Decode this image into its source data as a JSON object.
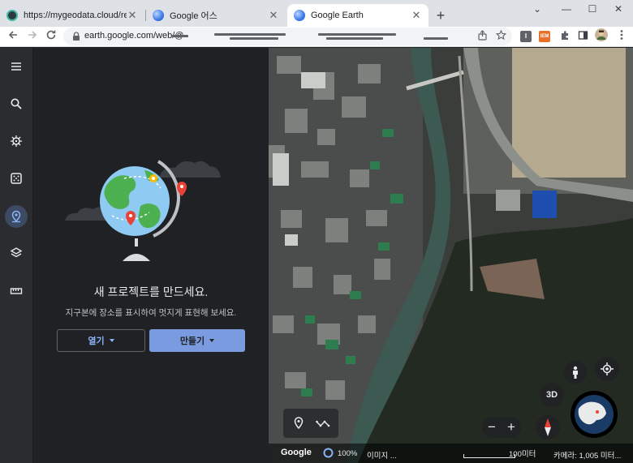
{
  "browser": {
    "tabs": [
      {
        "title": "https://mygeodata.cloud/result",
        "active": false
      },
      {
        "title": "Google 어스",
        "active": false
      },
      {
        "title": "Google Earth",
        "active": true
      }
    ],
    "new_tab": "+",
    "window_controls": {
      "minimize": "—",
      "maximize": "☐",
      "close": "✕",
      "dropdown": "⌄"
    },
    "url": "earth.google.com/web/@",
    "extensions": {
      "ext1": "I",
      "ext2": "IEM"
    }
  },
  "panel": {
    "heading": "새 프로젝트를 만드세요.",
    "subtext": "지구본에 장소를 표시하여 멋지게 표현해 보세요.",
    "open_label": "열기",
    "create_label": "만들기"
  },
  "map": {
    "view_3d": "3D",
    "zoom_minus": "−",
    "zoom_plus": "+",
    "footer": {
      "brand": "Google",
      "percent": "100%",
      "image_credit": "이미지 ...",
      "scale": "100미터",
      "camera": "카메라: 1,005 미터..."
    }
  },
  "colors": {
    "accent": "#8ab4f8",
    "create_button": "#7a9be0",
    "rail": "#2b2c2f",
    "panel": "#202124"
  }
}
